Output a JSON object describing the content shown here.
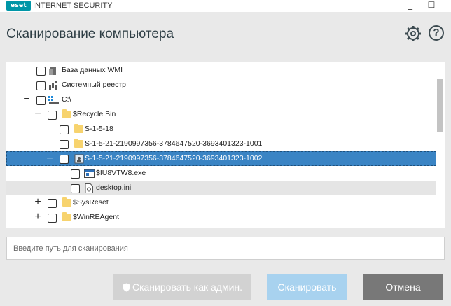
{
  "window": {
    "logo_text": "eset",
    "app_title": "INTERNET SECURITY",
    "minimize_glyph": "_",
    "maximize_glyph": "☐",
    "close_glyph": "✕"
  },
  "header": {
    "title": "Сканирование компьютера",
    "settings_icon": "gear-icon",
    "help_glyph": "?"
  },
  "tree": {
    "rows": [
      {
        "expander": "",
        "label": "База данных WMI",
        "icon": "wmi-database-icon"
      },
      {
        "expander": "",
        "label": "Системный реестр",
        "icon": "registry-icon"
      },
      {
        "expander": "−",
        "label": "C:\\",
        "icon": "drive-icon"
      },
      {
        "expander": "−",
        "label": "$Recycle.Bin",
        "icon": "folder-icon"
      },
      {
        "expander": "",
        "label": "S-1-5-18",
        "icon": "folder-icon"
      },
      {
        "expander": "",
        "label": "S-1-5-21-2190997356-3784647520-3693401323-1001",
        "icon": "folder-icon"
      },
      {
        "expander": "−",
        "label": "S-1-5-21-2190997356-3784647520-3693401323-1002",
        "icon": "user-folder-icon",
        "selected": true
      },
      {
        "expander": "",
        "label": "$IU8VTW8.exe",
        "icon": "exe-file-icon"
      },
      {
        "expander": "",
        "label": "desktop.ini",
        "icon": "settings-file-icon"
      },
      {
        "expander": "+",
        "label": "$SysReset",
        "icon": "folder-icon"
      },
      {
        "expander": "+",
        "label": "$WinREAgent",
        "icon": "folder-icon"
      }
    ]
  },
  "path_input": {
    "placeholder": "Введите путь для сканирования",
    "value": ""
  },
  "buttons": {
    "scan_as_admin": "Сканировать как админ.",
    "scan": "Сканировать",
    "cancel": "Отмена"
  },
  "colors": {
    "brand": "#0096a7",
    "selection": "#3a84c4",
    "scan_button": "#a8d2ef",
    "cancel_button": "#787878",
    "admin_button": "#d2d2d2"
  }
}
